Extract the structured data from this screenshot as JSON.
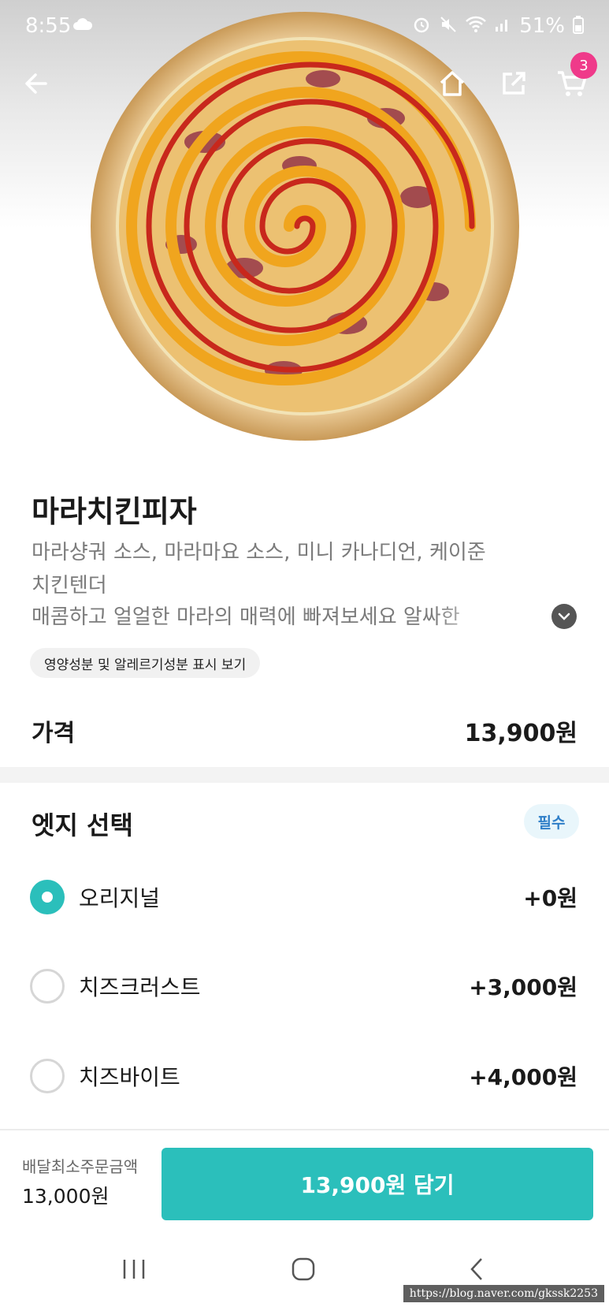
{
  "status_bar": {
    "time": "8:55",
    "battery": "51%",
    "icons": [
      "cloud-icon",
      "alarm-icon",
      "mute-icon",
      "wifi-icon",
      "signal-icon",
      "battery-icon"
    ]
  },
  "top_bar": {
    "icons": [
      "back-arrow-icon",
      "home-icon",
      "share-icon",
      "cart-icon"
    ],
    "cart_count": "3"
  },
  "product": {
    "name": "마라치킨피자",
    "description_lines": [
      "마라샹궈 소스, 마라마요 소스, 미니 카나디언, 케이준",
      "치킨텐더"
    ],
    "description_truncated": "매콤하고 얼얼한 마라의 매력에 빠져보세요 알싸한",
    "nutrition_chip": "영양성분 및 알레르기성분 표시 보기",
    "price_label": "가격",
    "price_value": "13,900원"
  },
  "edge_section": {
    "title": "엣지 선택",
    "required_badge": "필수",
    "options": [
      {
        "label": "오리지널",
        "price": "+0원",
        "selected": true
      },
      {
        "label": "치즈크러스트",
        "price": "+3,000원",
        "selected": false
      },
      {
        "label": "치즈바이트",
        "price": "+4,000원",
        "selected": false
      }
    ]
  },
  "bottom": {
    "min_order_label": "배달최소주문금액",
    "min_order_value": "13,000원",
    "add_button": "13,900원 담기"
  },
  "nav": {
    "icons": [
      "recent-apps-icon",
      "home-circle-icon",
      "back-chevron-icon"
    ]
  },
  "watermark": "https://blog.naver.com/gkssk2253",
  "colors": {
    "accent": "#2bbfbb",
    "badge": "#ef3a8a",
    "required_text": "#2f7fc8"
  }
}
